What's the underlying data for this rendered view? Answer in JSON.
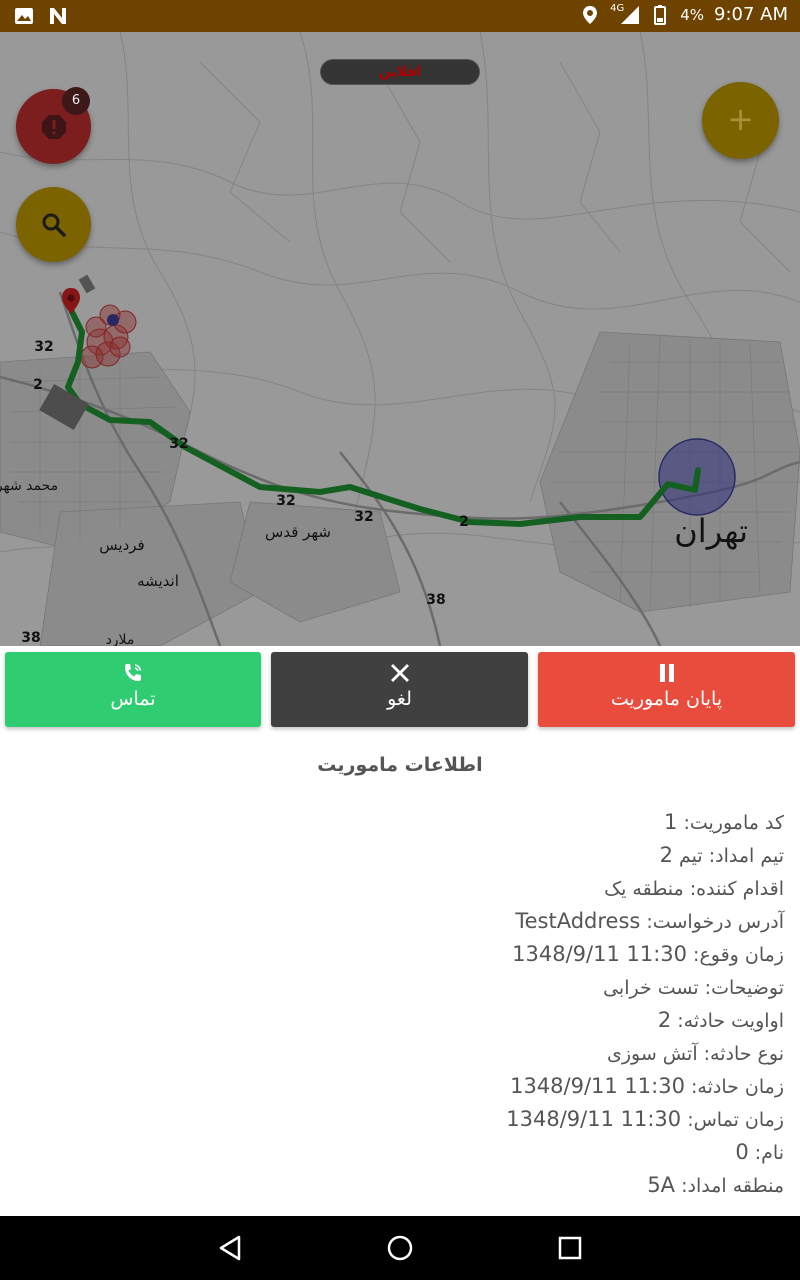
{
  "status_bar": {
    "network": "4G",
    "battery": "4%",
    "time": "9:07 AM"
  },
  "map": {
    "offline_label": "افلاین",
    "alert_badge_count": "6",
    "labels": {
      "tehran": "تهران",
      "shahr_qods": "شهر قدس",
      "pardis": "فردیس",
      "andisheh": "اندیشه",
      "mohammad_shahr": "محمد شهر",
      "malard": "ملارد",
      "road_32a": "32",
      "road_32b": "32",
      "road_32c": "32",
      "road_32d": "32",
      "road_2a": "2",
      "road_2b": "2",
      "road_38a": "38",
      "road_38b": "38"
    }
  },
  "actions": {
    "call_label": "تماس",
    "cancel_label": "لغو",
    "end_label": "پایان ماموریت"
  },
  "mission": {
    "title": "اطلاعات ماموریت",
    "rows": [
      {
        "label": "کد ماموریت: ",
        "value": "1"
      },
      {
        "label": "تیم امداد: تیم ",
        "value": "2"
      },
      {
        "label": "اقدام کننده: منطقه یک",
        "value": ""
      },
      {
        "label": "آدرس درخواست: ",
        "value": "TestAddress"
      },
      {
        "label": "زمان وقوع: ",
        "value": "1348/9/11   11:30"
      },
      {
        "label": "توضیحات: تست خرابی",
        "value": ""
      },
      {
        "label": "اواویت حادثه: ",
        "value": "2"
      },
      {
        "label": "نوع حادثه: آتش سوزی",
        "value": ""
      },
      {
        "label": "زمان حادثه: ",
        "value": "1348/9/11   11:30"
      },
      {
        "label": "زمان تماس: ",
        "value": "1348/9/11   11:30"
      },
      {
        "label": "نام: ",
        "value": "0"
      },
      {
        "label": "منطقه امداد: ",
        "value": "5A"
      }
    ]
  },
  "colors": {
    "status_bar": "#6e4300",
    "call": "#2fcc71",
    "cancel": "#404040",
    "end": "#e84c3d",
    "route": "#1e8a2e"
  }
}
